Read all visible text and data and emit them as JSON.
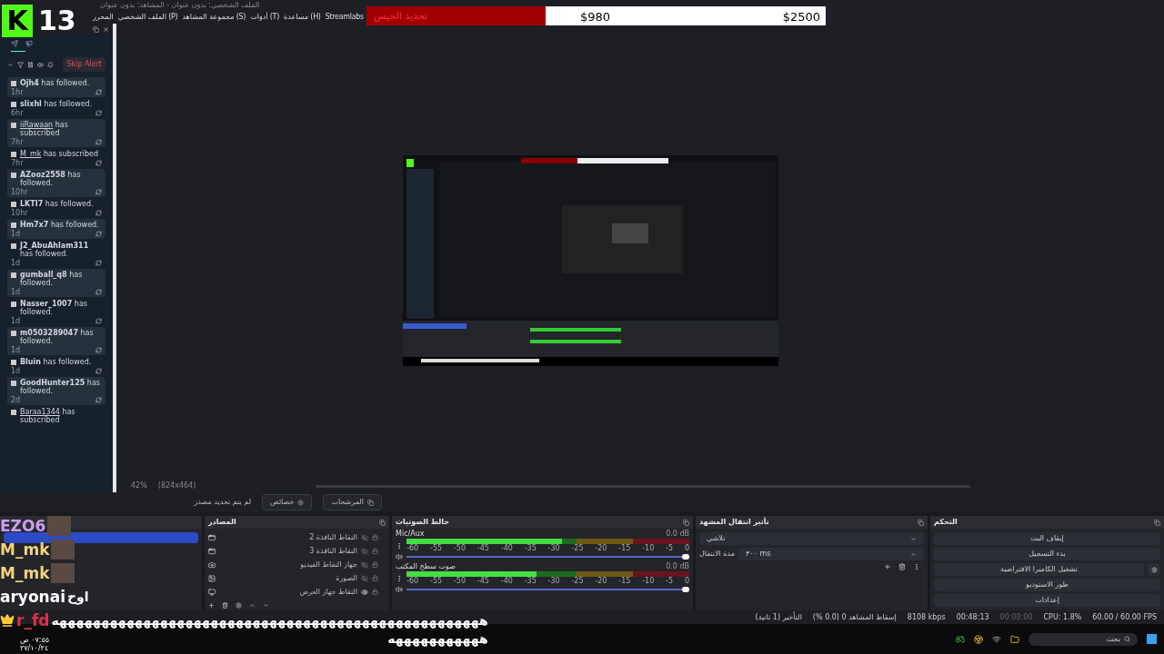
{
  "window": {
    "title": "الملف الشخصي: بدون عنوان - المشاهد: بدون عنوان"
  },
  "menu": [
    "Streamlabs",
    "(H) مساعدة",
    "(T) أدوات",
    "(S) مجموعة المشاهد",
    "(P) الملف الشخصي",
    "المحرر"
  ],
  "overlay_badge": {
    "letter": "K",
    "count": "13"
  },
  "goal_bar": {
    "label": "تحديد الجيس",
    "current": "$980",
    "target": "$2500",
    "level": 0.39
  },
  "events_dock": {
    "skip_button": "Skip Alert",
    "events": [
      {
        "kind": "followed",
        "user": "Ojh4",
        "action": "has followed.",
        "time": "1hr"
      },
      {
        "kind": "followed",
        "user": "slixhl",
        "action": "has followed.",
        "time": "6hr"
      },
      {
        "kind": "subscribed",
        "user": "iiRawaan",
        "action": "has subscribed",
        "time": "7hr"
      },
      {
        "kind": "subscribed",
        "user": "M_mk",
        "action": "has subscribed",
        "time": "7hr"
      },
      {
        "kind": "followed",
        "user": "AZooz2558",
        "action": "has followed.",
        "time": "10hr"
      },
      {
        "kind": "followed",
        "user": "LKTI7",
        "action": "has followed.",
        "time": "10hr"
      },
      {
        "kind": "followed",
        "user": "Hm7x7",
        "action": "has followed.",
        "time": "1d"
      },
      {
        "kind": "followed",
        "user": "J2_AbuAhlam311",
        "action": "has followed.",
        "time": "1d"
      },
      {
        "kind": "followed",
        "user": "gumball_q8",
        "action": "has followed.",
        "time": "1d"
      },
      {
        "kind": "followed",
        "user": "Nasser_1007",
        "action": "has followed.",
        "time": "1d"
      },
      {
        "kind": "followed",
        "user": "m0503289047",
        "action": "has followed.",
        "time": "1d"
      },
      {
        "kind": "followed",
        "user": "Bluin",
        "action": "has followed.",
        "time": "1d"
      },
      {
        "kind": "followed",
        "user": "GoodHunter125",
        "action": "has followed.",
        "time": "2d"
      },
      {
        "kind": "subscribed",
        "user": "Baraa1344",
        "action": "has subscribed"
      }
    ]
  },
  "preview_bar": {
    "zoom": "42%",
    "resolution": "(824x464)"
  },
  "source_toolbar": {
    "buttons": [
      "المرشحات",
      "خصائص"
    ],
    "status": "لم يتم تحديد مصدر"
  },
  "sources": {
    "title": "المصادر",
    "items": [
      {
        "kind": "window",
        "name": "التقاط النافذة 2",
        "visible": false
      },
      {
        "kind": "window",
        "name": "التقاط النافذة 3",
        "visible": false
      },
      {
        "kind": "camera",
        "name": "جهاز التقاط الفيديو",
        "visible": false
      },
      {
        "kind": "image",
        "name": "الصورة",
        "visible": false
      },
      {
        "kind": "display",
        "name": "التقاط جهاز العرض",
        "visible": true
      }
    ]
  },
  "mixer": {
    "title": "خالط الصوتيات",
    "channels": [
      {
        "name": "Mic/Aux",
        "reading": "0.0 dB",
        "meter": {
          "level": 0.55
        },
        "volume": {
          "level": 1
        },
        "ticks": [
          "0",
          "-5",
          "-10",
          "-15",
          "-20",
          "-25",
          "-30",
          "-35",
          "-40",
          "-45",
          "-50",
          "-55",
          "-60"
        ]
      },
      {
        "name": "صوت سطح المكتب",
        "reading": "0.0 dB",
        "meter": {
          "level": 0.46
        },
        "volume": {
          "level": 1
        },
        "ticks": [
          "0",
          "-5",
          "-10",
          "-15",
          "-20",
          "-25",
          "-30",
          "-35",
          "-40",
          "-45",
          "-50",
          "-55",
          "-60"
        ]
      }
    ]
  },
  "transitions": {
    "title": "تأثير انتقال المشهد",
    "effect": "تلاشي",
    "duration_label": "مدة الانتقال",
    "duration": "٣٠٠ ms"
  },
  "controls": {
    "title": "التحكم",
    "buttons": [
      "إيقاف البث",
      "بدء التسجيل",
      "تشغيل الكاميرا الافتراضية",
      "طور الاستوديو",
      "إعدادات"
    ]
  },
  "status_bar": [
    "60.00 / 60.00 FPS",
    "CPU: 1.8%",
    "00:00:00",
    "00:48:13",
    "8108 kbps",
    "إسقاط المشاهد 0 (0.0 %)",
    "التأخير (1 ثانية)"
  ],
  "chat": [
    {
      "user": "EZO6",
      "color": "#c9a0f0",
      "badge": false
    },
    {
      "user": "M_mk",
      "color": "#f2d27a",
      "badge": false
    },
    {
      "user": "M_mk",
      "color": "#f2d27a",
      "badge": false
    },
    {
      "user": "aryonai",
      "color": "#ffffff",
      "badge": false,
      "message": "اوح"
    },
    {
      "user": "r_fd",
      "color": "#e0304a",
      "badge": true,
      "message": "هههههههههههههههههههههههههههههههههههههههههههههههههههه",
      "message_cont": "هههههههههههه"
    }
  ],
  "taskbar": {
    "search": "بحث",
    "time": "٠٧:٥٥ ص",
    "date": "٢٧/١٠/٢٤"
  }
}
